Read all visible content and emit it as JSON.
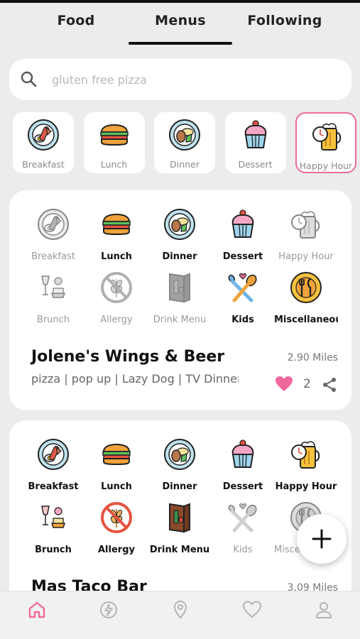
{
  "tabs": {
    "items": [
      "Food",
      "Menus",
      "Following"
    ],
    "active": "Menus"
  },
  "search": {
    "placeholder": "gluten free pizza"
  },
  "chips": [
    {
      "label": "Breakfast",
      "icon": "breakfast-plate-icon"
    },
    {
      "label": "Lunch",
      "icon": "sandwich-icon"
    },
    {
      "label": "Dinner",
      "icon": "dinner-plate-icon"
    },
    {
      "label": "Dessert",
      "icon": "cupcake-icon"
    },
    {
      "label": "Happy Hour",
      "icon": "beer-clock-icon",
      "selected": true
    }
  ],
  "restaurants": [
    {
      "name": "Jolene's Wings & Beer",
      "distance": "2.90 Miles",
      "tags": "pizza | pop up | Lazy Dog | TV Dinner",
      "likes": "2",
      "categories": [
        {
          "label": "Breakfast",
          "icon": "breakfast-plate-icon",
          "available": false
        },
        {
          "label": "Lunch",
          "icon": "sandwich-icon",
          "available": true
        },
        {
          "label": "Dinner",
          "icon": "dinner-plate-icon",
          "available": true
        },
        {
          "label": "Dessert",
          "icon": "cupcake-icon",
          "available": true
        },
        {
          "label": "Happy Hour",
          "icon": "beer-clock-icon",
          "available": false
        },
        {
          "label": "Brunch",
          "icon": "brunch-icon",
          "available": false
        },
        {
          "label": "Allergy",
          "icon": "no-wheat-icon",
          "available": false
        },
        {
          "label": "Drink Menu",
          "icon": "drink-menu-icon",
          "available": false
        },
        {
          "label": "Kids",
          "icon": "kids-utensils-icon",
          "available": true
        },
        {
          "label": "Miscellaneous",
          "icon": "utensils-circle-icon",
          "available": true
        }
      ]
    },
    {
      "name": "Mas Taco Bar",
      "distance": "3.09 Miles",
      "categories": [
        {
          "label": "Breakfast",
          "icon": "breakfast-plate-icon",
          "available": true
        },
        {
          "label": "Lunch",
          "icon": "sandwich-icon",
          "available": true
        },
        {
          "label": "Dinner",
          "icon": "dinner-plate-icon",
          "available": true
        },
        {
          "label": "Dessert",
          "icon": "cupcake-icon",
          "available": true
        },
        {
          "label": "Happy Hour",
          "icon": "beer-clock-icon",
          "available": true
        },
        {
          "label": "Brunch",
          "icon": "brunch-icon",
          "available": true
        },
        {
          "label": "Allergy",
          "icon": "no-wheat-icon",
          "available": true
        },
        {
          "label": "Drink Menu",
          "icon": "drink-menu-icon",
          "available": true
        },
        {
          "label": "Kids",
          "icon": "kids-utensils-icon",
          "available": false
        },
        {
          "label": "Miscellaneous",
          "icon": "utensils-circle-icon",
          "available": false
        }
      ]
    }
  ],
  "fab": {
    "icon": "plus-icon"
  },
  "bottom_nav": [
    {
      "icon": "home-icon",
      "active": true
    },
    {
      "icon": "flash-icon"
    },
    {
      "icon": "map-pin-icon"
    },
    {
      "icon": "heart-icon"
    },
    {
      "icon": "user-icon"
    }
  ],
  "colors": {
    "accent": "#f06a9c",
    "heart": "#f0679c",
    "card": "#ffffff",
    "background": "#ececec"
  }
}
